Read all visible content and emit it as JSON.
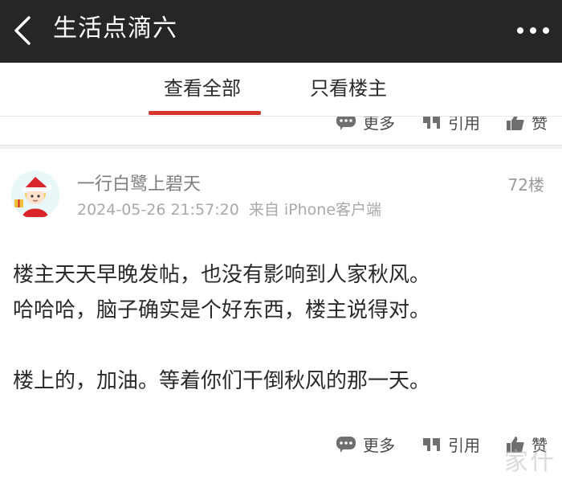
{
  "header": {
    "title": "生活点滴六"
  },
  "tabs": [
    {
      "label": "查看全部"
    },
    {
      "label": "只看楼主"
    }
  ],
  "actions": {
    "more": "更多",
    "quote": "引用",
    "like": "赞"
  },
  "post": {
    "username": "一行白鹭上碧天",
    "floor": "72楼",
    "datetime": "2024-05-26 21:57:20",
    "source": "来自 iPhone客户端",
    "lines": [
      "楼主天天早晚发帖，也没有影响到人家秋风。",
      "哈哈哈，脑子确实是个好东西，楼主说得对。",
      "楼上的，加油。等着你们干倒秋风的那一天。"
    ]
  },
  "watermark": "家什"
}
